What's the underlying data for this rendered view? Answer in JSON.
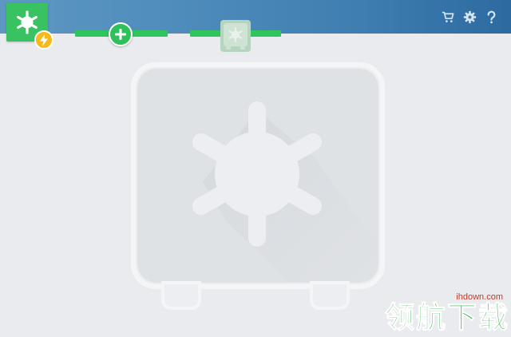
{
  "header": {
    "icons": [
      "cart-icon",
      "gear-icon",
      "help-icon"
    ],
    "gradient": [
      "#5e97c2",
      "#2c6aa0"
    ]
  },
  "logo": {
    "icon": "safe-wheel-icon",
    "badge_icon": "lightning-icon",
    "color": "#38c262",
    "badge_color": "#f6b81a"
  },
  "steps": {
    "add_icon": "plus-icon",
    "safe_icon": "safe-icon",
    "bar_color": "#30c45e"
  },
  "main": {
    "illustration": "safe-icon"
  },
  "watermark": {
    "url": "ihdown.com",
    "text": "领航下载"
  }
}
